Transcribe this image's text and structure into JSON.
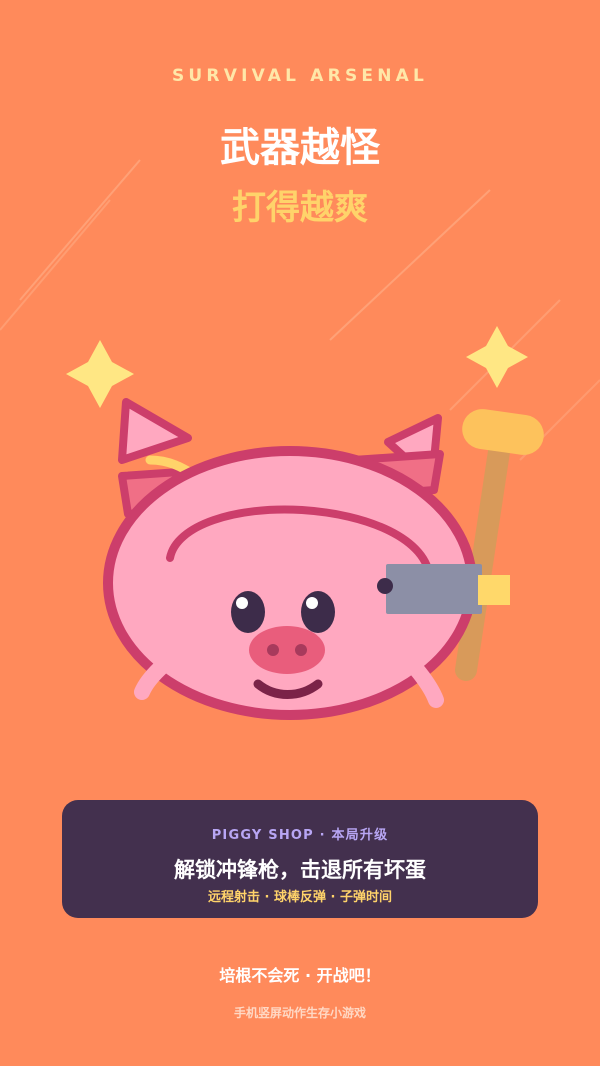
{
  "header": {
    "eyebrow": "SURVIVAL ARSENAL",
    "headline_line_1": "武器越怪",
    "headline_line_2": "打得越爽"
  },
  "shop_card": {
    "title": "PIGGY SHOP · 本局升级",
    "main_text": "解锁冲锋枪，击退所有坏蛋",
    "sub_text": "远程射击 · 球棒反弹 · 子弹时间"
  },
  "cta": {
    "text": "培根不会死 · 开战吧！"
  },
  "footer": {
    "text": "手机竖屏动作生存小游戏"
  },
  "icons": {
    "sparkle_left": "sparkle-icon",
    "sparkle_right": "sparkle-icon",
    "bat": "baseball-bat-icon",
    "gun": "gun-icon"
  },
  "colors": {
    "background": "#FF8A5B",
    "eyebrow": "#FFE7A8",
    "headline_white": "#FFFFFF",
    "headline_yellow": "#FFD36A",
    "card_bg": "#43304E",
    "card_title": "#B8A6F4",
    "pig_pink": "#FFA8C0",
    "pig_outline": "#CC3E6B"
  }
}
